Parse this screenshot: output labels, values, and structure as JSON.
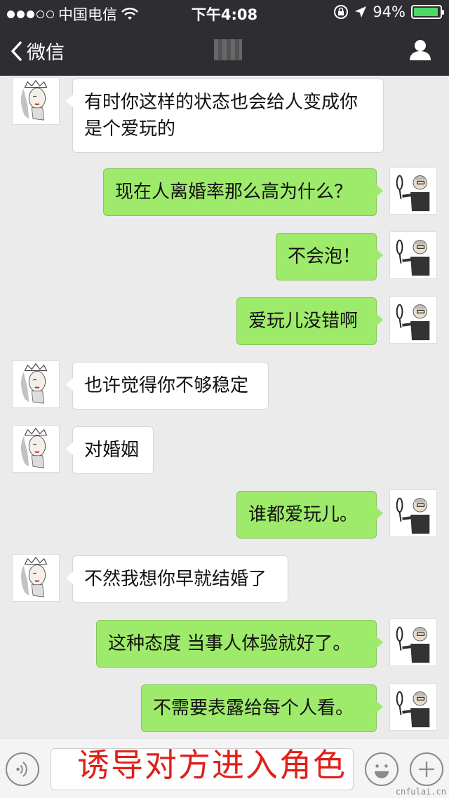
{
  "status_bar": {
    "carrier": "中国电信",
    "time": "下午4:08",
    "battery_percent": "94%",
    "battery_level": 0.94,
    "signal_bars_filled": 3,
    "signal_bars_total": 5
  },
  "nav_bar": {
    "back_label": "微信"
  },
  "messages": [
    {
      "side": "left",
      "text": "有时你这样的状态也会给人变成你是个爱玩的"
    },
    {
      "side": "right",
      "text": "现在人离婚率那么高为什么？"
    },
    {
      "side": "right",
      "text": "不会泡！"
    },
    {
      "side": "right",
      "text": "爱玩儿没错啊"
    },
    {
      "side": "left",
      "text": "也许觉得你不够稳定"
    },
    {
      "side": "left",
      "text": "对婚姻"
    },
    {
      "side": "right",
      "text": "谁都爱玩儿。"
    },
    {
      "side": "left",
      "text": "不然我想你早就结婚了"
    },
    {
      "side": "right",
      "text": "这种态度 当事人体验就好了。"
    },
    {
      "side": "right",
      "text": "不需要表露给每个人看。"
    }
  ],
  "caption": "诱导对方进入角色",
  "watermark": "cnfulai.cn",
  "colors": {
    "bar_bg": "#2e2e32",
    "chat_bg": "#ebebeb",
    "sent_bubble": "#9eea6a",
    "received_bubble": "#ffffff",
    "caption": "#e0201a"
  }
}
